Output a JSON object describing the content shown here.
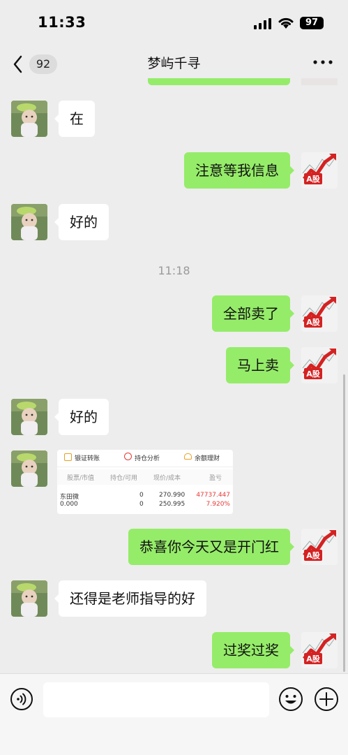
{
  "status_bar": {
    "time": "11:33",
    "battery": "97"
  },
  "header": {
    "back_count": "92",
    "title": "梦屿千寻"
  },
  "messages": [
    {
      "from": "them",
      "text": "在"
    },
    {
      "from": "me",
      "text": "注意等我信息"
    },
    {
      "from": "them",
      "text": "好的"
    },
    {
      "from": "me",
      "text": "全部卖了"
    },
    {
      "from": "me",
      "text": "马上卖"
    },
    {
      "from": "them",
      "text": "好的"
    },
    {
      "from": "me",
      "text": "恭喜你今天又是开门红"
    },
    {
      "from": "them",
      "text": "还得是老师指导的好"
    },
    {
      "from": "me",
      "text": "过奖过奖"
    }
  ],
  "timestamp": "11:18",
  "my_avatar_label": "A股",
  "shared_card": {
    "tabs": [
      "银证转账",
      "持仓分析",
      "余额理财"
    ],
    "headers": [
      "股票/市值",
      "持仓/可用",
      "现价/成本",
      "盈亏"
    ],
    "row": {
      "stock": "东田微",
      "market_value": "0.000",
      "hold": "0",
      "available": "0",
      "price": "270.990",
      "cost": "250.995",
      "pnl": "47737.447",
      "pnl_pct": "7.920%"
    }
  },
  "colors": {
    "bubble_out": "#95ec69",
    "bubble_in": "#ffffff",
    "background": "#ededed",
    "loss_red": "#e53935"
  },
  "icons": [
    "voice-icon",
    "emoji-icon",
    "plus-icon",
    "back-icon",
    "more-icon",
    "signal-icon",
    "wifi-icon"
  ]
}
